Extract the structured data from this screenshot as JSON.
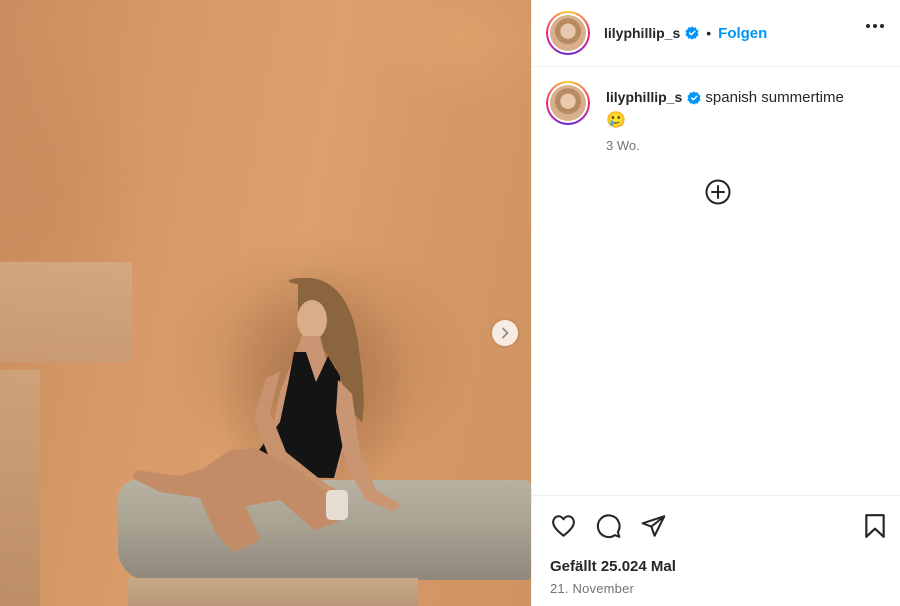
{
  "post": {
    "username": "lilyphillip_s",
    "follow_label": "Folgen",
    "separator": "•",
    "caption_text": "spanish summertime",
    "caption_emoji": "🥲",
    "age": "3 Wo.",
    "likes": "Gefällt 25.024 Mal",
    "date": "21. November"
  },
  "colors": {
    "accent": "#0095f6",
    "text": "#262626",
    "muted": "#737373",
    "verified": "#0095f6"
  },
  "icons": [
    "verified-badge-icon",
    "more-options-icon",
    "add-comment-icon",
    "heart-icon",
    "comment-icon",
    "share-icon",
    "bookmark-icon",
    "chevron-right-icon"
  ]
}
